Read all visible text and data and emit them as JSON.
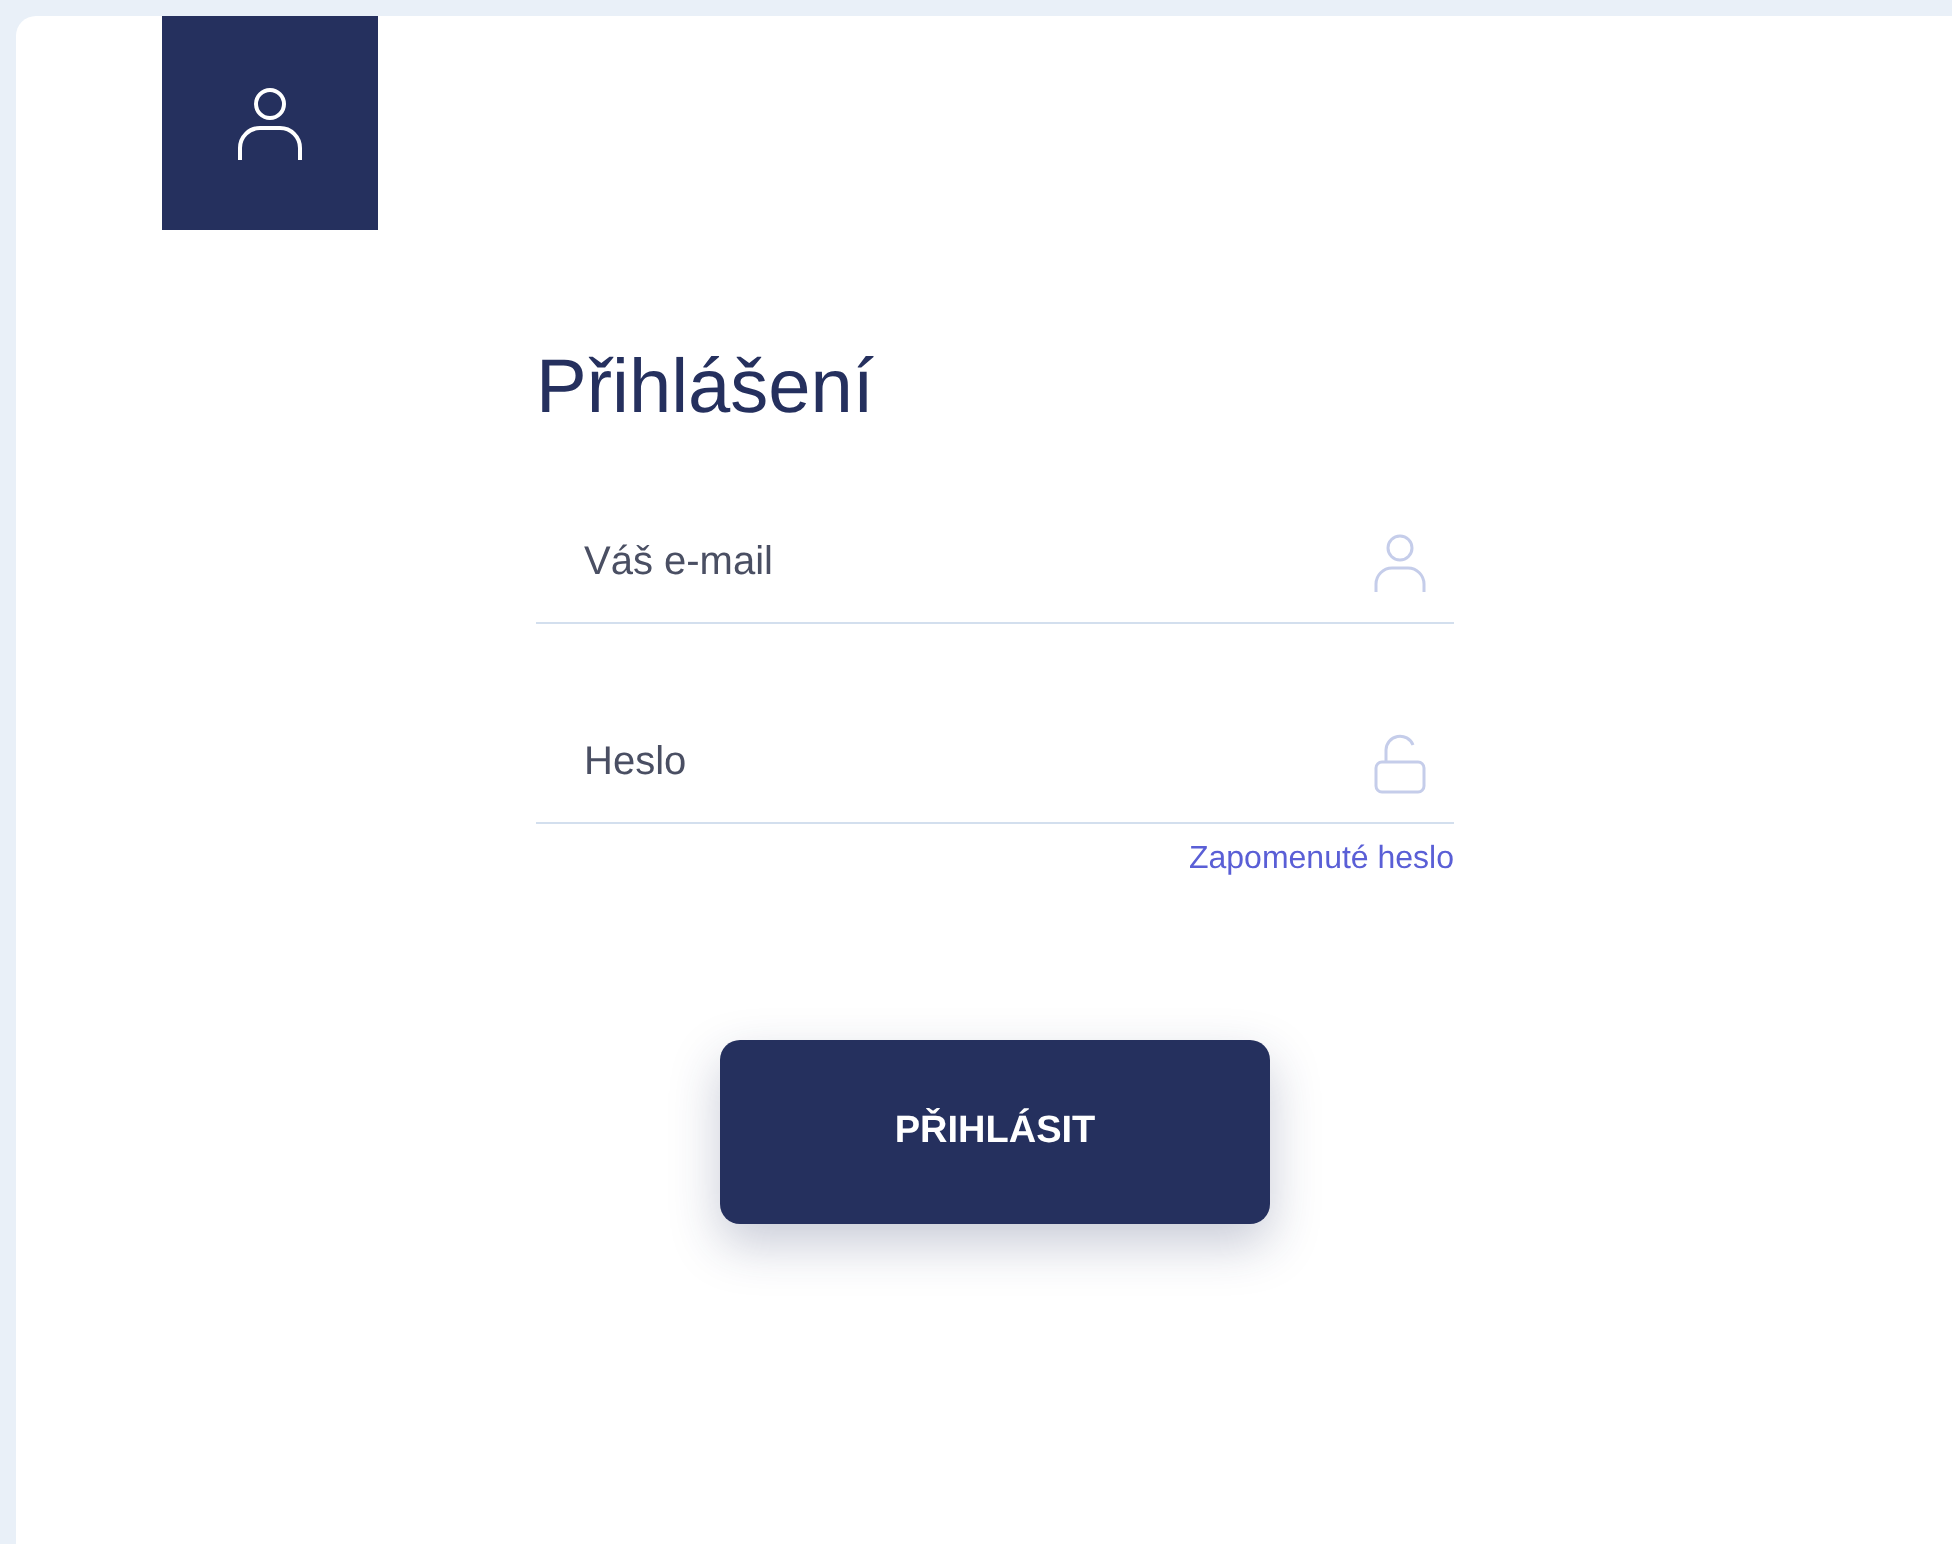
{
  "heading": "Přihlášení",
  "fields": [
    {
      "kind": "email",
      "placeholder": "Váš e-mail"
    },
    {
      "kind": "password",
      "placeholder": "Heslo"
    }
  ],
  "forgot_link": "Zapomenuté heslo",
  "submit_button": "PŘIHLÁSIT"
}
